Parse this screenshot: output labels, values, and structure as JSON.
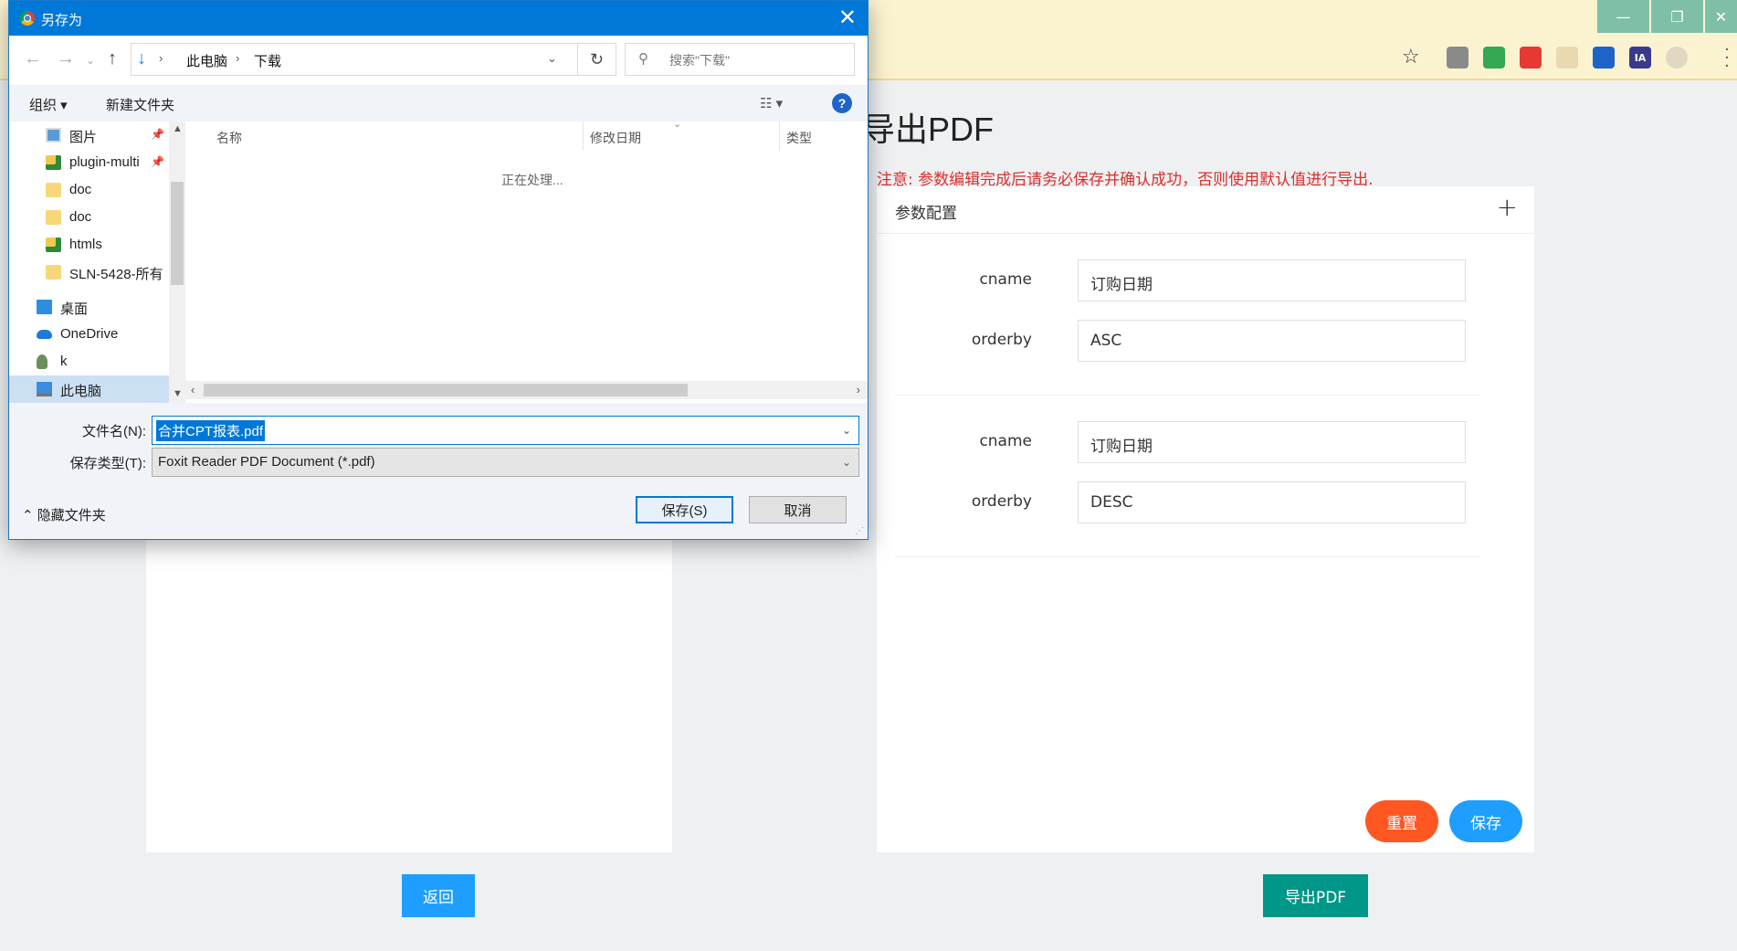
{
  "browser": {
    "window_buttons": [
      "—",
      "❐",
      "✕"
    ],
    "extensions": [
      {
        "name": "tab-extension-icon",
        "text": "",
        "color": "#8a8a8a"
      },
      {
        "name": "colorful-extension-icon",
        "text": "",
        "color": "#34a853"
      },
      {
        "name": "red-extension-icon",
        "text": "",
        "color": "#e53935"
      },
      {
        "name": "faded-extension-icon",
        "text": "",
        "color": "#e8d9b0"
      },
      {
        "name": "blue-extension-icon",
        "text": "",
        "color": "#1e64c8"
      },
      {
        "name": "ia-extension-icon",
        "text": "IA",
        "color": "#3a3a8c"
      },
      {
        "name": "profile-icon",
        "text": "",
        "color": "#e0d8c0"
      }
    ]
  },
  "page": {
    "title": "导出PDF",
    "notice": "注意: 参数编辑完成后请务必保存并确认成功，否则使用默认值进行导出.",
    "config_title": "参数配置",
    "add_symbol": "+",
    "groups": [
      {
        "fields": [
          {
            "label": "cname",
            "value": "订购日期"
          },
          {
            "label": "orderby",
            "value": "ASC"
          }
        ]
      },
      {
        "fields": [
          {
            "label": "cname",
            "value": "订购日期"
          },
          {
            "label": "orderby",
            "value": "DESC"
          }
        ]
      }
    ],
    "reset_label": "重置",
    "save_label": "保存",
    "back_label": "返回",
    "export_label": "导出PDF",
    "colors": {
      "reset": "#ff5722",
      "save": "#1e9fff",
      "back": "#1e9fff",
      "export": "#009688"
    }
  },
  "dialog": {
    "title": "另存为",
    "breadcrumb": [
      "此电脑",
      "下载"
    ],
    "search_placeholder": "搜索\"下载\"",
    "organize": "组织 ▾",
    "new_folder": "新建文件夹",
    "nav_items": [
      {
        "label": "图片",
        "icon": "pictures-folder-icon",
        "pinned": true,
        "selected": false
      },
      {
        "label": "plugin-multi",
        "icon": "synced-folder-icon",
        "pinned": true,
        "selected": false
      },
      {
        "label": "doc",
        "icon": "folder-icon",
        "pinned": false,
        "selected": false
      },
      {
        "label": "doc",
        "icon": "folder-icon",
        "pinned": false,
        "selected": false
      },
      {
        "label": "htmls",
        "icon": "synced-folder-icon",
        "pinned": false,
        "selected": false
      },
      {
        "label": "SLN-5428-所有",
        "icon": "folder-icon",
        "pinned": false,
        "selected": false
      },
      {
        "label": "桌面",
        "icon": "desktop-icon",
        "pinned": false,
        "selected": false
      },
      {
        "label": "OneDrive",
        "icon": "onedrive-icon",
        "pinned": false,
        "selected": false
      },
      {
        "label": "k",
        "icon": "user-icon",
        "pinned": false,
        "selected": false
      },
      {
        "label": "此电脑",
        "icon": "computer-icon",
        "pinned": false,
        "selected": true
      }
    ],
    "columns": [
      "名称",
      "修改日期",
      "类型"
    ],
    "processing": "正在处理...",
    "filename_label": "文件名(N):",
    "filename": "合并CPT报表.pdf",
    "type_label": "保存类型(T):",
    "file_type": "Foxit Reader PDF Document (*.pdf)",
    "hide_folders": "隐藏文件夹",
    "save_button": "保存(S)",
    "cancel_button": "取消"
  }
}
